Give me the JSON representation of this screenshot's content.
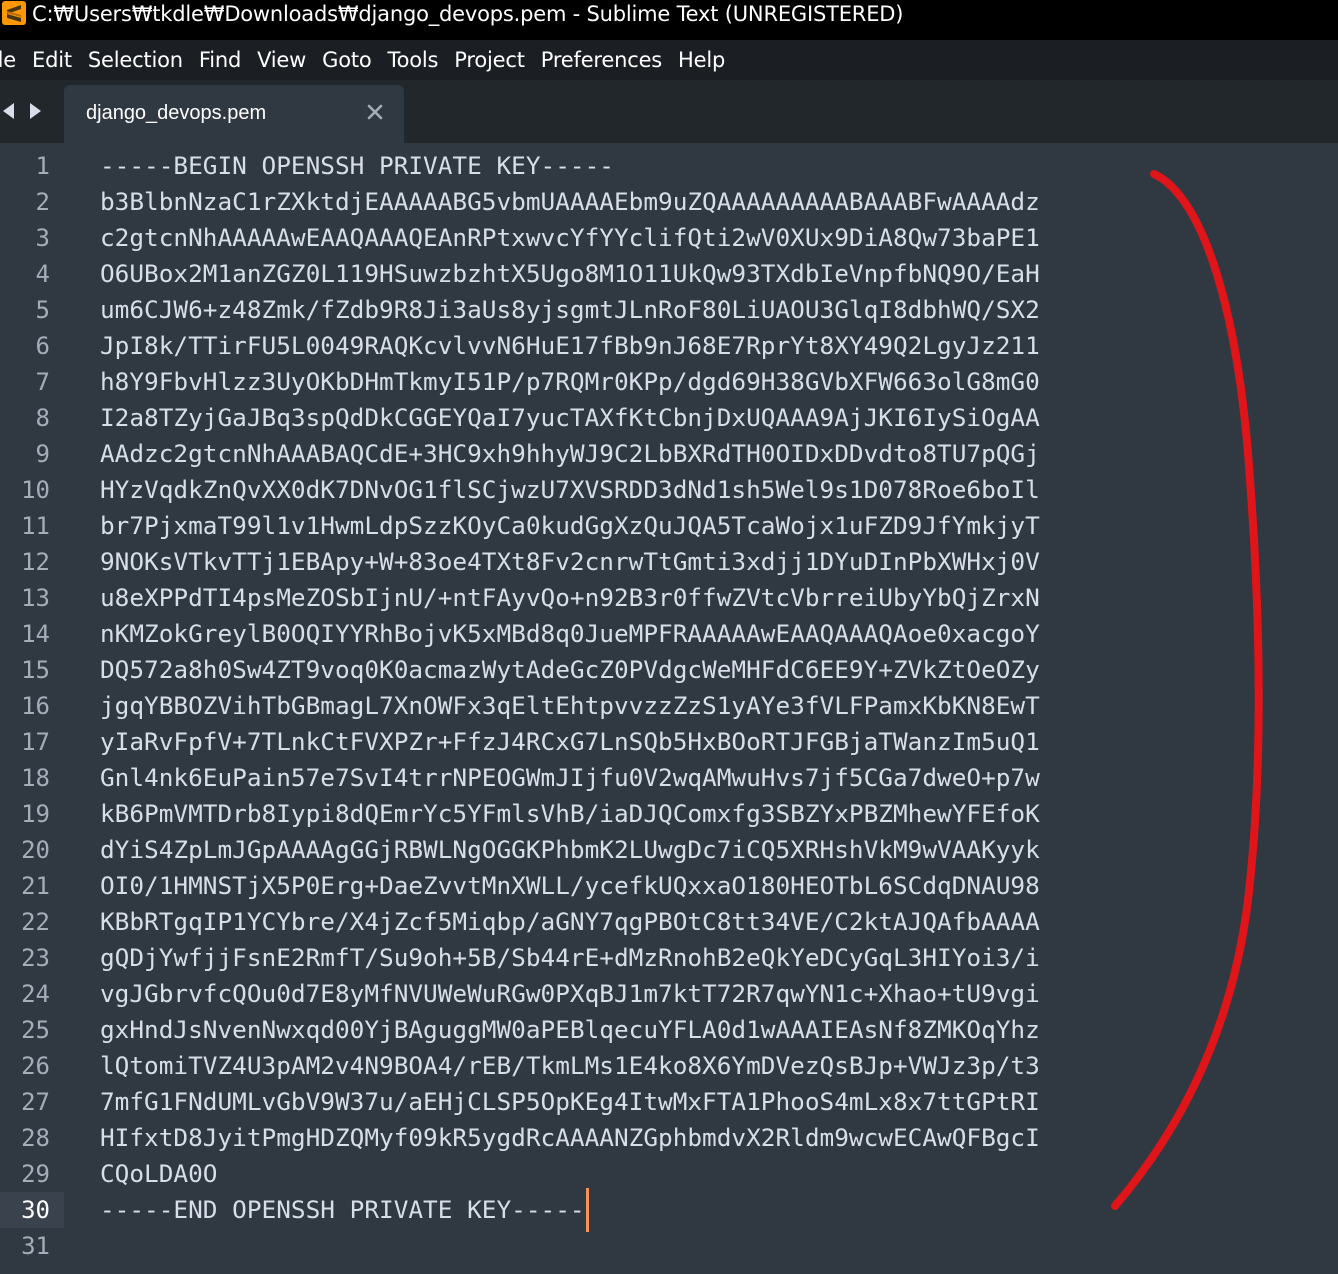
{
  "window": {
    "title": "C:₩Users₩tkdle₩Downloads₩django_devops.pem - Sublime Text (UNREGISTERED)",
    "app_icon": "sublime-text-icon"
  },
  "menu": {
    "items": [
      "ile",
      "Edit",
      "Selection",
      "Find",
      "View",
      "Goto",
      "Tools",
      "Project",
      "Preferences",
      "Help"
    ]
  },
  "tabs": {
    "nav_left_icon": "triangle-left-icon",
    "nav_right_icon": "triangle-right-icon",
    "active": {
      "label": "django_devops.pem",
      "close_icon": "close-icon"
    }
  },
  "editor": {
    "active_line": 30,
    "lines": [
      "-----BEGIN OPENSSH PRIVATE KEY-----",
      "b3BlbnNzaC1rZXktdjEAAAAABG5vbmUAAAAEbm9uZQAAAAAAAAABAAABFwAAAAdz",
      "c2gtcnNhAAAAAwEAAQAAAQEAnRPtxwvcYfYYclifQti2wV0XUx9DiA8Qw73baPE1",
      "O6UBox2M1anZGZ0L119HSuwzbzhtX5Ugo8M1O11UkQw93TXdbIeVnpfbNQ9O/EaH",
      "um6CJW6+z48Zmk/fZdb9R8Ji3aUs8yjsgmtJLnRoF80LiUAOU3GlqI8dbhWQ/SX2",
      "JpI8k/TTirFU5L0049RAQKcvlvvN6HuE17fBb9nJ68E7RprYt8XY49Q2LgyJz211",
      "h8Y9FbvHlzz3UyOKbDHmTkmyI51P/p7RQMr0KPp/dgd69H38GVbXFW663olG8mG0",
      "I2a8TZyjGaJBq3spQdDkCGGEYQaI7yucTAXfKtCbnjDxUQAAA9AjJKI6IySiOgAA",
      "AAdzc2gtcnNhAAABAQCdE+3HC9xh9hhyWJ9C2LbBXRdTH0OIDxDDvdto8TU7pQGj",
      "HYzVqdkZnQvXX0dK7DNvOG1flSCjwzU7XVSRDD3dNd1sh5Wel9s1D078Roe6boIl",
      "br7PjxmaT99l1v1HwmLdpSzzKOyCa0kudGgXzQuJQA5TcaWojx1uFZD9JfYmkjyT",
      "9NOKsVTkvTTj1EBApy+W+83oe4TXt8Fv2cnrwTtGmti3xdjj1DYuDInPbXWHxj0V",
      "u8eXPPdTI4psMeZOSbIjnU/+ntFAyvQo+n92B3r0ffwZVtcVbrreiUbyYbQjZrxN",
      "nKMZokGreylB0OQIYYRhBojvK5xMBd8q0JueMPFRAAAAAwEAAQAAAQAoe0xacgoY",
      "DQ572a8h0Sw4ZT9voq0K0acmazWytAdeGcZ0PVdgcWeMHFdC6EE9Y+ZVkZtOeOZy",
      "jgqYBBOZVihTbGBmagL7XnOWFx3qEltEhtpvvzzZzS1yAYe3fVLFPamxKbKN8EwT",
      "yIaRvFpfV+7TLnkCtFVXPZr+FfzJ4RCxG7LnSQb5HxBOoRTJFGBjaTWanzIm5uQ1",
      "Gnl4nk6EuPain57e7SvI4trrNPEOGWmJIjfu0V2wqAMwuHvs7jf5CGa7dweO+p7w",
      "kB6PmVMTDrb8Iypi8dQEmrYc5YFmlsVhB/iaDJQComxfg3SBZYxPBZMhewYFEfoK",
      "dYiS4ZpLmJGpAAAAgGGjRBWLNgOGGKPhbmK2LUwgDc7iCQ5XRHshVkM9wVAAKyyk",
      "OI0/1HMNSTjX5P0Erg+DaeZvvtMnXWLL/ycefkUQxxaO180HEOTbL6SCdqDNAU98",
      "KBbRTgqIP1YCYbre/X4jZcf5Miqbp/aGNY7qgPBOtC8tt34VE/C2ktAJQAfbAAAA",
      "gQDjYwfjjFsnE2RmfT/Su9oh+5B/Sb44rE+dMzRnohB2eQkYeDCyGqL3HIYoi3/i",
      "vgJGbrvfcQOu0d7E8yMfNVUWeWuRGw0PXqBJ1m7ktT72R7qwYN1c+Xhao+tU9vgi",
      "gxHndJsNvenNwxqd00YjBAguggMW0aPEBlqecuYFLA0d1wAAAIEAsNf8ZMKOqYhz",
      "lQtomiTVZ4U3pAM2v4N9BOA4/rEB/TkmLMs1E4ko8X6YmDVezQsBJp+VWJz3p/t3",
      "7mfG1FNdUMLvGbV9W37u/aEHjCLSP5OpKEg4ItwMxFTA1PhooS4mLx8x7ttGPtRI",
      "HIfxtD8JyitPmgHDZQMyf09kR5ygdRcAAAANZGphbmdvX2Rldm9wcwECAwQFBgcI",
      "CQoLDA0O",
      "-----END OPENSSH PRIVATE KEY-----",
      ""
    ]
  },
  "overlay": {
    "annotation": "red-bracket-stroke",
    "color": "#e0151a"
  },
  "colors": {
    "background": "#303841",
    "text": "#d8dee9",
    "cursor": "#f99157",
    "title_bar": "#000000",
    "menu_bar": "#1b1f23",
    "tab_bar": "#22272c"
  }
}
